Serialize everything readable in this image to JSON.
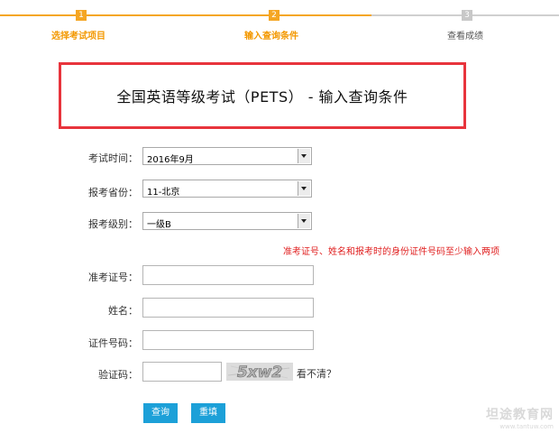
{
  "steps": [
    {
      "num": "1",
      "label": "选择考试项目"
    },
    {
      "num": "2",
      "label": "输入查询条件"
    },
    {
      "num": "3",
      "label": "查看成绩"
    }
  ],
  "title": "全国英语等级考试（PETS） - 输入查询条件",
  "form": {
    "exam_time": {
      "label": "考试时间：",
      "value": "2016年9月"
    },
    "province": {
      "label": "报考省份：",
      "value": "11-北京"
    },
    "level": {
      "label": "报考级别：",
      "value": "一级B"
    },
    "note": "准考证号、姓名和报考时的身份证件号码至少输入两项",
    "admission": {
      "label": "准考证号：",
      "value": ""
    },
    "name": {
      "label": "姓名：",
      "value": ""
    },
    "id_number": {
      "label": "证件号码：",
      "value": ""
    },
    "captcha": {
      "label": "验证码：",
      "value": "",
      "image_text": "5xw2",
      "refresh_link": "看不清？"
    }
  },
  "buttons": {
    "query": "查询",
    "reset": "重填"
  },
  "watermark": {
    "main": "坦途教育网",
    "sub": "www.tantuw.com"
  },
  "colors": {
    "accent": "#f5a623",
    "title_border": "#e8343c",
    "note": "#e02020",
    "button": "#1ca0d8"
  }
}
